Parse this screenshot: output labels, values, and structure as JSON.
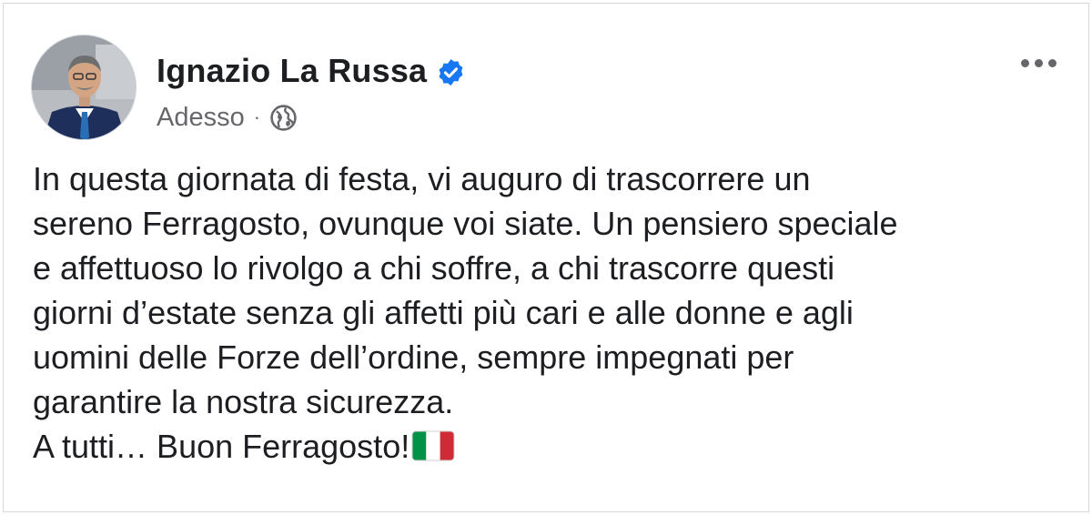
{
  "post": {
    "author_name": "Ignazio La Russa",
    "verified": true,
    "timestamp": "Adesso",
    "separator": "·",
    "visibility_icon": "globe-icon",
    "more_options_icon": "more-horizontal-icon",
    "text_lines": [
      "In questa giornata di festa, vi auguro di trascorrere un",
      "sereno Ferragosto, ovunque voi siate. Un pensiero speciale",
      "e affettuoso lo rivolgo a chi soffre, a chi trascorre questi",
      "giorni d’estate senza gli affetti più cari e alle donne e agli",
      "uomini delle Forze dell’ordine, sempre impegnati per",
      "garantire la nostra sicurezza."
    ],
    "closing_line": "A tutti… Buon Ferragosto!",
    "closing_emoji": "italy-flag-icon"
  },
  "colors": {
    "author_text": "#1c1e21",
    "meta_text": "#65676b",
    "verified_blue": "#1877f2",
    "flag_green": "#009246",
    "flag_white": "#ffffff",
    "flag_red": "#ce2b37"
  }
}
